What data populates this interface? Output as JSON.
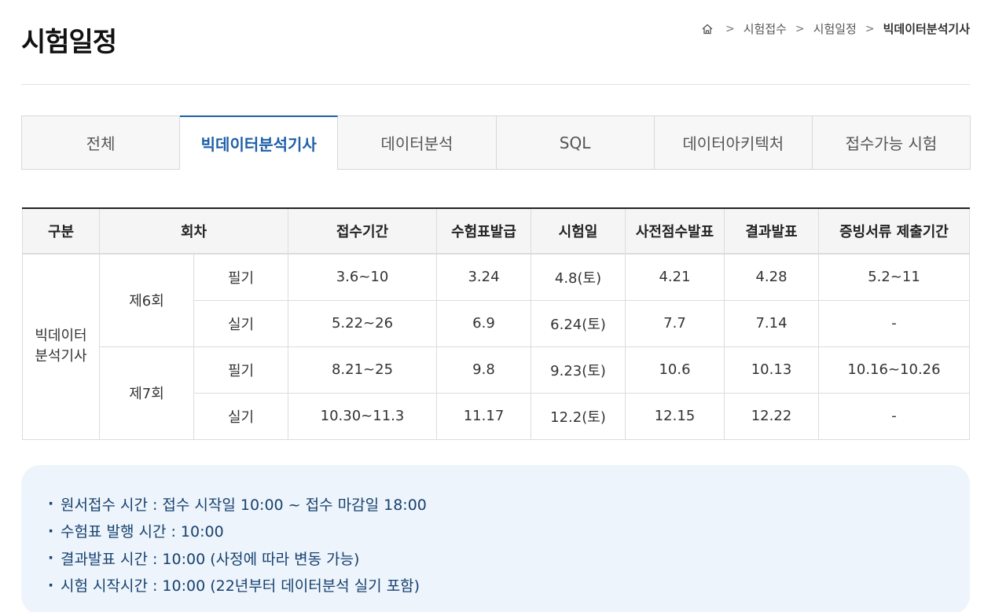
{
  "page_title": "시험일정",
  "breadcrumb": {
    "home_icon": "home-icon",
    "items": [
      "시험접수",
      "시험일정",
      "빅데이터분석기사"
    ]
  },
  "tabs": [
    {
      "label": "전체",
      "active": false
    },
    {
      "label": "빅데이터분석기사",
      "active": true
    },
    {
      "label": "데이터분석",
      "active": false
    },
    {
      "label": "SQL",
      "active": false
    },
    {
      "label": "데이터아키텍처",
      "active": false
    },
    {
      "label": "접수가능 시험",
      "active": false
    }
  ],
  "table": {
    "headers": {
      "category": "구분",
      "round": "회차",
      "registration": "접수기간",
      "ticket": "수험표발급",
      "exam_date": "시험일",
      "pre_score": "사전점수발표",
      "result": "결과발표",
      "documents": "증빙서류 제출기간"
    },
    "category": "빅데이터\n분석기사",
    "category_line1": "빅데이터",
    "category_line2": "분석기사",
    "rounds": [
      {
        "name": "제6회",
        "rows": [
          {
            "type": "필기",
            "registration": "3.6~10",
            "ticket": "3.24",
            "exam_date": "4.8(토)",
            "pre_score": "4.21",
            "result": "4.28",
            "documents": "5.2~11"
          },
          {
            "type": "실기",
            "registration": "5.22~26",
            "ticket": "6.9",
            "exam_date": "6.24(토)",
            "pre_score": "7.7",
            "result": "7.14",
            "documents": "-"
          }
        ]
      },
      {
        "name": "제7회",
        "rows": [
          {
            "type": "필기",
            "registration": "8.21~25",
            "ticket": "9.8",
            "exam_date": "9.23(토)",
            "pre_score": "10.6",
            "result": "10.13",
            "documents": "10.16~10.26"
          },
          {
            "type": "실기",
            "registration": "10.30~11.3",
            "ticket": "11.17",
            "exam_date": "12.2(토)",
            "pre_score": "12.15",
            "result": "12.22",
            "documents": "-"
          }
        ]
      }
    ]
  },
  "notice": {
    "bullet": "·",
    "items": [
      "원서접수 시간 : 접수 시작일 10:00 ~ 접수 마감일 18:00",
      "수험표 발행 시간 : 10:00",
      "결과발표 시간 : 10:00 (사정에 따라 변동 가능)",
      "시험 시작시간 : 10:00 (22년부터 데이터분석 실기 포함)"
    ]
  },
  "colors": {
    "accent": "#1d5fa8",
    "notice_bg": "#edf4fb",
    "notice_text": "#17416f"
  }
}
